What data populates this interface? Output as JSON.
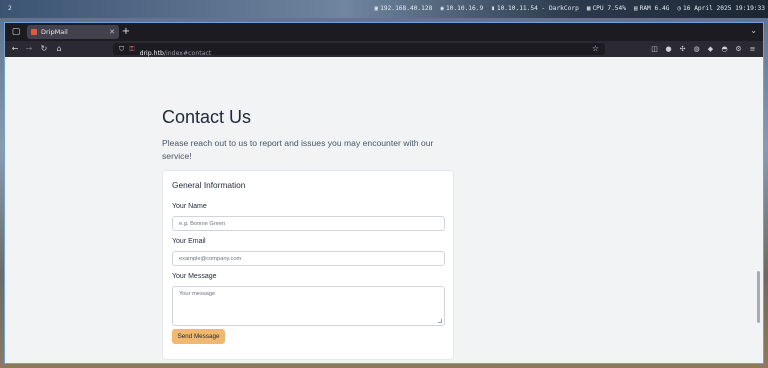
{
  "system_bar": {
    "workspace": "2",
    "items": [
      {
        "icon": "monitor-icon",
        "text": "192.168.40.128"
      },
      {
        "icon": "network-icon",
        "text": "10.10.16.9"
      },
      {
        "icon": "vpn-icon",
        "text": "10.10.11.54 - DarkCorp"
      },
      {
        "icon": "cpu-icon",
        "text": "CPU 7.54%"
      },
      {
        "icon": "ram-icon",
        "text": "RAM 6.4G"
      },
      {
        "icon": "clock-icon",
        "text": "16 April 2025 19:19:33"
      }
    ]
  },
  "browser": {
    "tab_title": "DripMail",
    "url_host": "drip.htb",
    "url_path": "/index#contact"
  },
  "page": {
    "heading": "Contact Us",
    "lead": "Please reach out to us to report and issues you may encounter with our service!",
    "card_title": "General Information",
    "name_label": "Your Name",
    "name_placeholder": "e.g. Bonnie Green",
    "email_label": "Your Email",
    "email_placeholder": "example@company.com",
    "message_label": "Your Message",
    "message_placeholder": "Your message",
    "submit_label": "Send Message"
  },
  "colors": {
    "accent_button": "#f0b870",
    "window_border": "#6fa2d8"
  }
}
